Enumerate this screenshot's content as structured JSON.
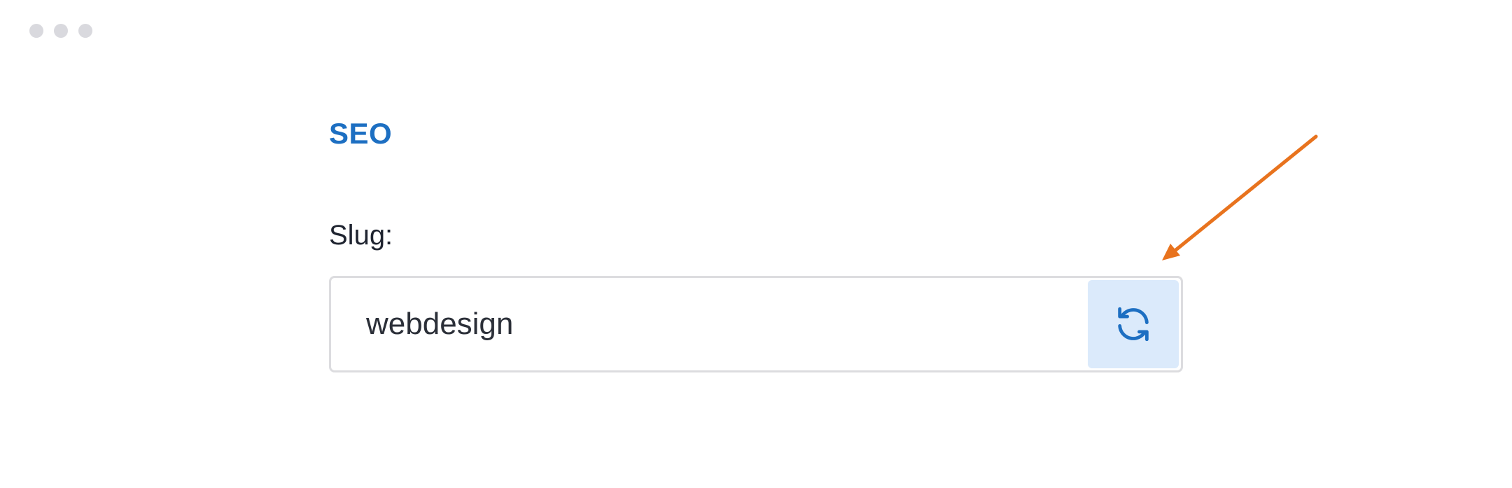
{
  "window": {
    "controls": [
      "dot",
      "dot",
      "dot"
    ]
  },
  "seo": {
    "title": "SEO",
    "slug_label": "Slug:",
    "slug_value": "webdesign",
    "regenerate_icon": "refresh-icon"
  },
  "colors": {
    "accent": "#1d6fc2",
    "button_bg": "#dbeafb",
    "annotation": "#e8731e",
    "window_dot": "#d9d9de"
  }
}
